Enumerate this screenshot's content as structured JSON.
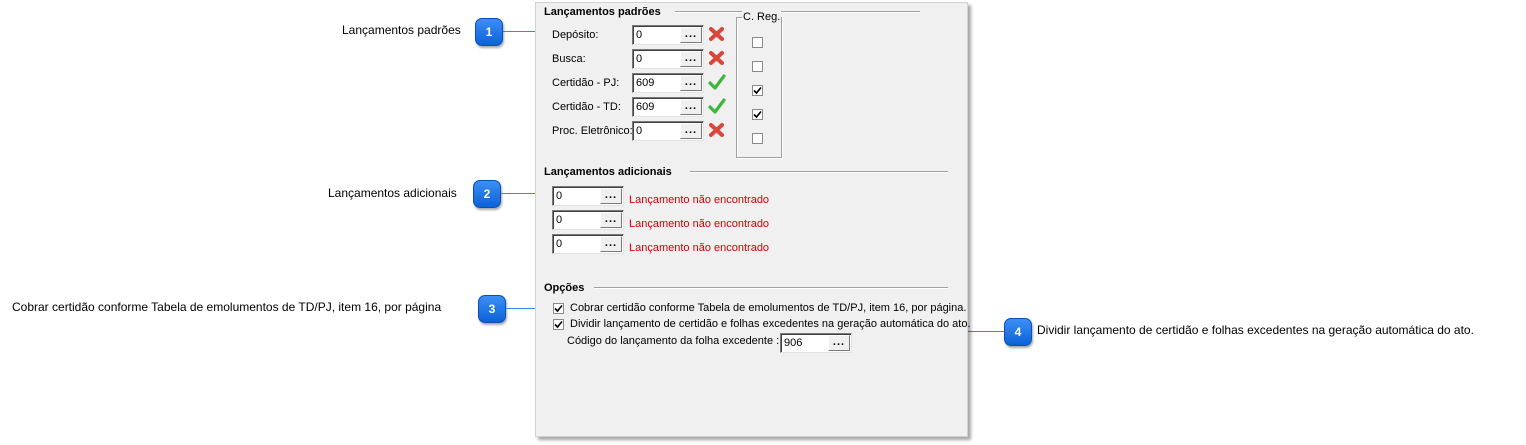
{
  "callouts": [
    {
      "number": "1",
      "text": "Lançamentos padrões"
    },
    {
      "number": "2",
      "text": "Lançamentos adicionais"
    },
    {
      "number": "3",
      "text": "Cobrar certidão conforme Tabela de emolumentos de TD/PJ, item 16, por página"
    },
    {
      "number": "4",
      "text": "Dividir lançamento de certidão e folhas excedentes na geração automática do ato."
    }
  ],
  "padroes": {
    "title": "Lançamentos padrões",
    "creg_title": "C. Reg.",
    "rows": [
      {
        "label": "Depósito:",
        "value": "0",
        "status": "x-icon",
        "creg_checked": false
      },
      {
        "label": "Busca:",
        "value": "0",
        "status": "x-icon",
        "creg_checked": false
      },
      {
        "label": "Certidão - PJ:",
        "value": "609",
        "status": "check-icon",
        "creg_checked": true
      },
      {
        "label": "Certidão - TD:",
        "value": "609",
        "status": "check-icon",
        "creg_checked": true
      },
      {
        "label": "Proc. Eletrônico:",
        "value": "0",
        "status": "x-icon",
        "creg_checked": false
      }
    ]
  },
  "adicionais": {
    "title": "Lançamentos adicionais",
    "rows": [
      {
        "value": "0",
        "message": "Lançamento não encontrado"
      },
      {
        "value": "0",
        "message": "Lançamento não encontrado"
      },
      {
        "value": "0",
        "message": "Lançamento não encontrado"
      }
    ]
  },
  "opcoes": {
    "title": "Opções",
    "cobrar_label": "Cobrar certidão conforme Tabela de emolumentos de TD/PJ, item 16, por página.",
    "cobrar_checked": true,
    "dividir_label": "Dividir lançamento de certidão e folhas excedentes na geração automática do ato.",
    "dividir_checked": true,
    "codigo_label": "Código do lançamento da folha excedente :",
    "codigo_value": "906"
  },
  "lookup_button_label": "...",
  "colors": {
    "accent": "#0b62d8",
    "error": "#d40000",
    "ok": "#3cb53c",
    "x": "#d9463a"
  }
}
